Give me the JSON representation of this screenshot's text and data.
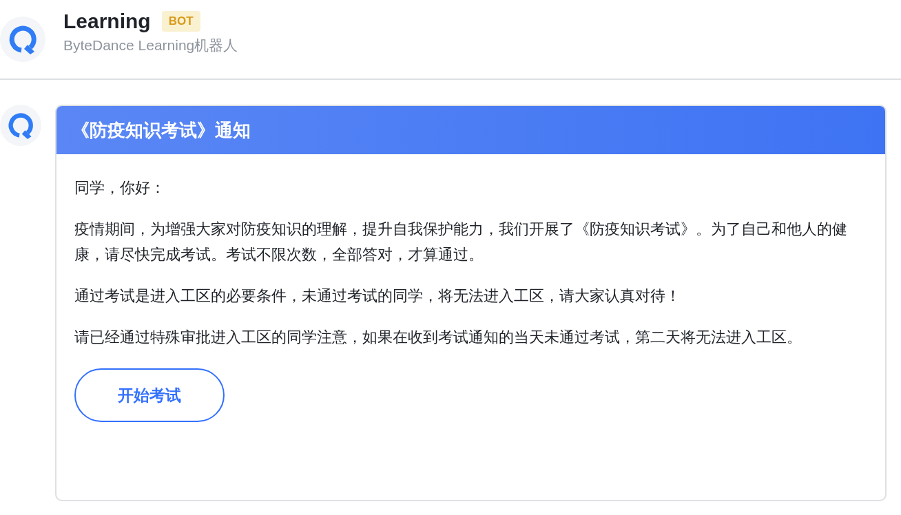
{
  "header": {
    "name": "Learning",
    "badge": "BOT",
    "subtitle": "ByteDance Learning机器人"
  },
  "message": {
    "card": {
      "title": "《防疫知识考试》通知",
      "paragraphs": [
        "同学，你好：",
        "疫情期间，为增强大家对防疫知识的理解，提升自我保护能力，我们开展了《防疫知识考试》。为了自己和他人的健康，请尽快完成考试。考试不限次数，全部答对，才算通过。",
        "通过考试是进入工区的必要条件，未通过考试的同学，将无法进入工区，请大家认真对待！",
        "请已经通过特殊审批进入工区的同学注意，如果在收到考试通知的当天未通过考试，第二天将无法进入工区。"
      ],
      "button": "开始考试"
    }
  }
}
